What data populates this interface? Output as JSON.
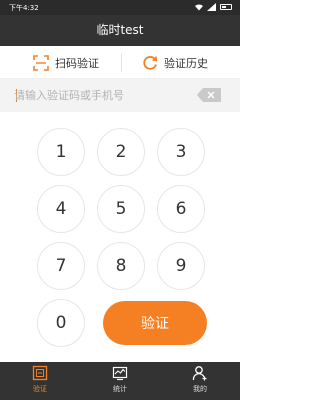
{
  "status_bar": {
    "time": "下午4:32"
  },
  "title": "临时test",
  "actions": {
    "scan_label": "扫码验证",
    "history_label": "验证历史"
  },
  "input": {
    "placeholder": "请输入验证码或手机号",
    "value": ""
  },
  "keypad": {
    "keys": [
      "1",
      "2",
      "3",
      "4",
      "5",
      "6",
      "7",
      "8",
      "9",
      "0"
    ],
    "verify_label": "验证"
  },
  "tabs": [
    {
      "label": "验证",
      "icon": "verify-icon",
      "active": true
    },
    {
      "label": "统计",
      "icon": "chart-icon",
      "active": false
    },
    {
      "label": "我的",
      "icon": "user-icon",
      "active": false
    }
  ],
  "colors": {
    "accent": "#f58024",
    "header": "#333333"
  }
}
